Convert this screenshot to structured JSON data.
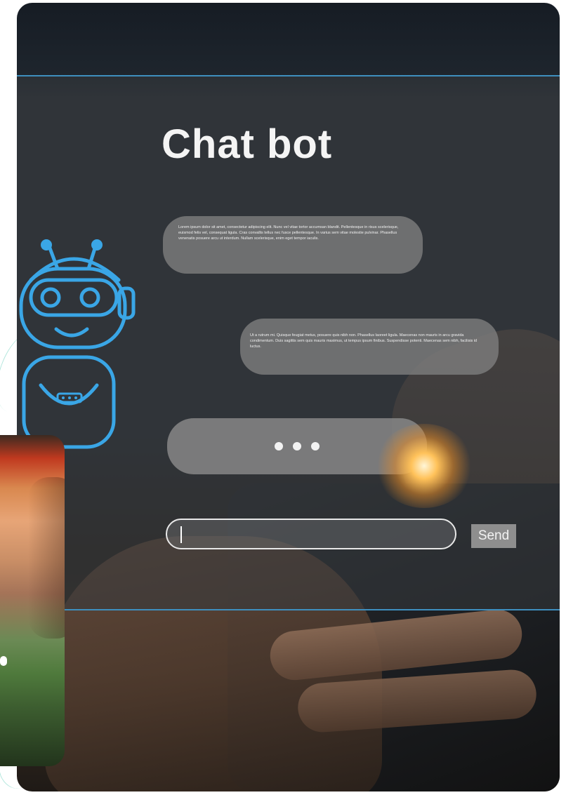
{
  "title": "Chat bot",
  "messages": [
    {
      "sender": "bot",
      "text": "Lorem ipsum dolor sit amet, consectetur adipiscing elit. Nunc vel vitae tortor accumsan blandit. Pellentesque in risus scelerisque, euismod felis vel, consequat ligula. Cras convallis tellus nec fusce pellentesque. In varius sem vitae molestie pulvinar. Phasellus venenatis posuere arcu ut interdum. Nullam scelerisque, enim eget tempor iaculis."
    },
    {
      "sender": "user",
      "text": "Ut a rutrum mi. Quisque feugiat metus, posuere quis nibh non. Phasellus laoreet ligula. Maecenas non mauris in arcu gravida condimentum. Duis sagittis sem quis mauris maximus, ut tempus ipsum finibus. Suspendisse potenti. Maecenas sem nibh, facilisis id luctus."
    }
  ],
  "typing_indicator": "•••",
  "input": {
    "value": "",
    "placeholder": ""
  },
  "send_label": "Send",
  "colors": {
    "accent_line": "#3e8fbf",
    "robot_stroke": "#3aa6e6",
    "bubble": "#8a8a8a",
    "title": "#f4f4f4"
  },
  "icons": {
    "robot": "robot-icon"
  }
}
